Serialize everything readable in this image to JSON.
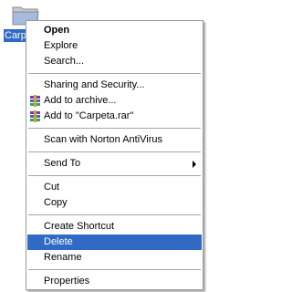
{
  "desktop": {
    "folder_label": "Carpe",
    "folder_icon": "folder-icon",
    "selection_color": "#316ac5"
  },
  "menu": {
    "items": [
      {
        "label": "Open",
        "bold": true
      },
      {
        "label": "Explore"
      },
      {
        "label": "Search..."
      },
      {
        "label": "Sharing and Security..."
      },
      {
        "label": "Add to archive...",
        "icon": "winrar-archive-icon"
      },
      {
        "label": "Add to \"Carpeta.rar\"",
        "icon": "winrar-archive-icon"
      },
      {
        "label": "Scan with Norton AntiVirus"
      },
      {
        "label": "Send To",
        "submenu": true,
        "icon": "submenu-arrow-icon"
      },
      {
        "label": "Cut"
      },
      {
        "label": "Copy"
      },
      {
        "label": "Create Shortcut"
      },
      {
        "label": "Delete",
        "highlighted": true
      },
      {
        "label": "Rename"
      },
      {
        "label": "Properties"
      }
    ]
  }
}
